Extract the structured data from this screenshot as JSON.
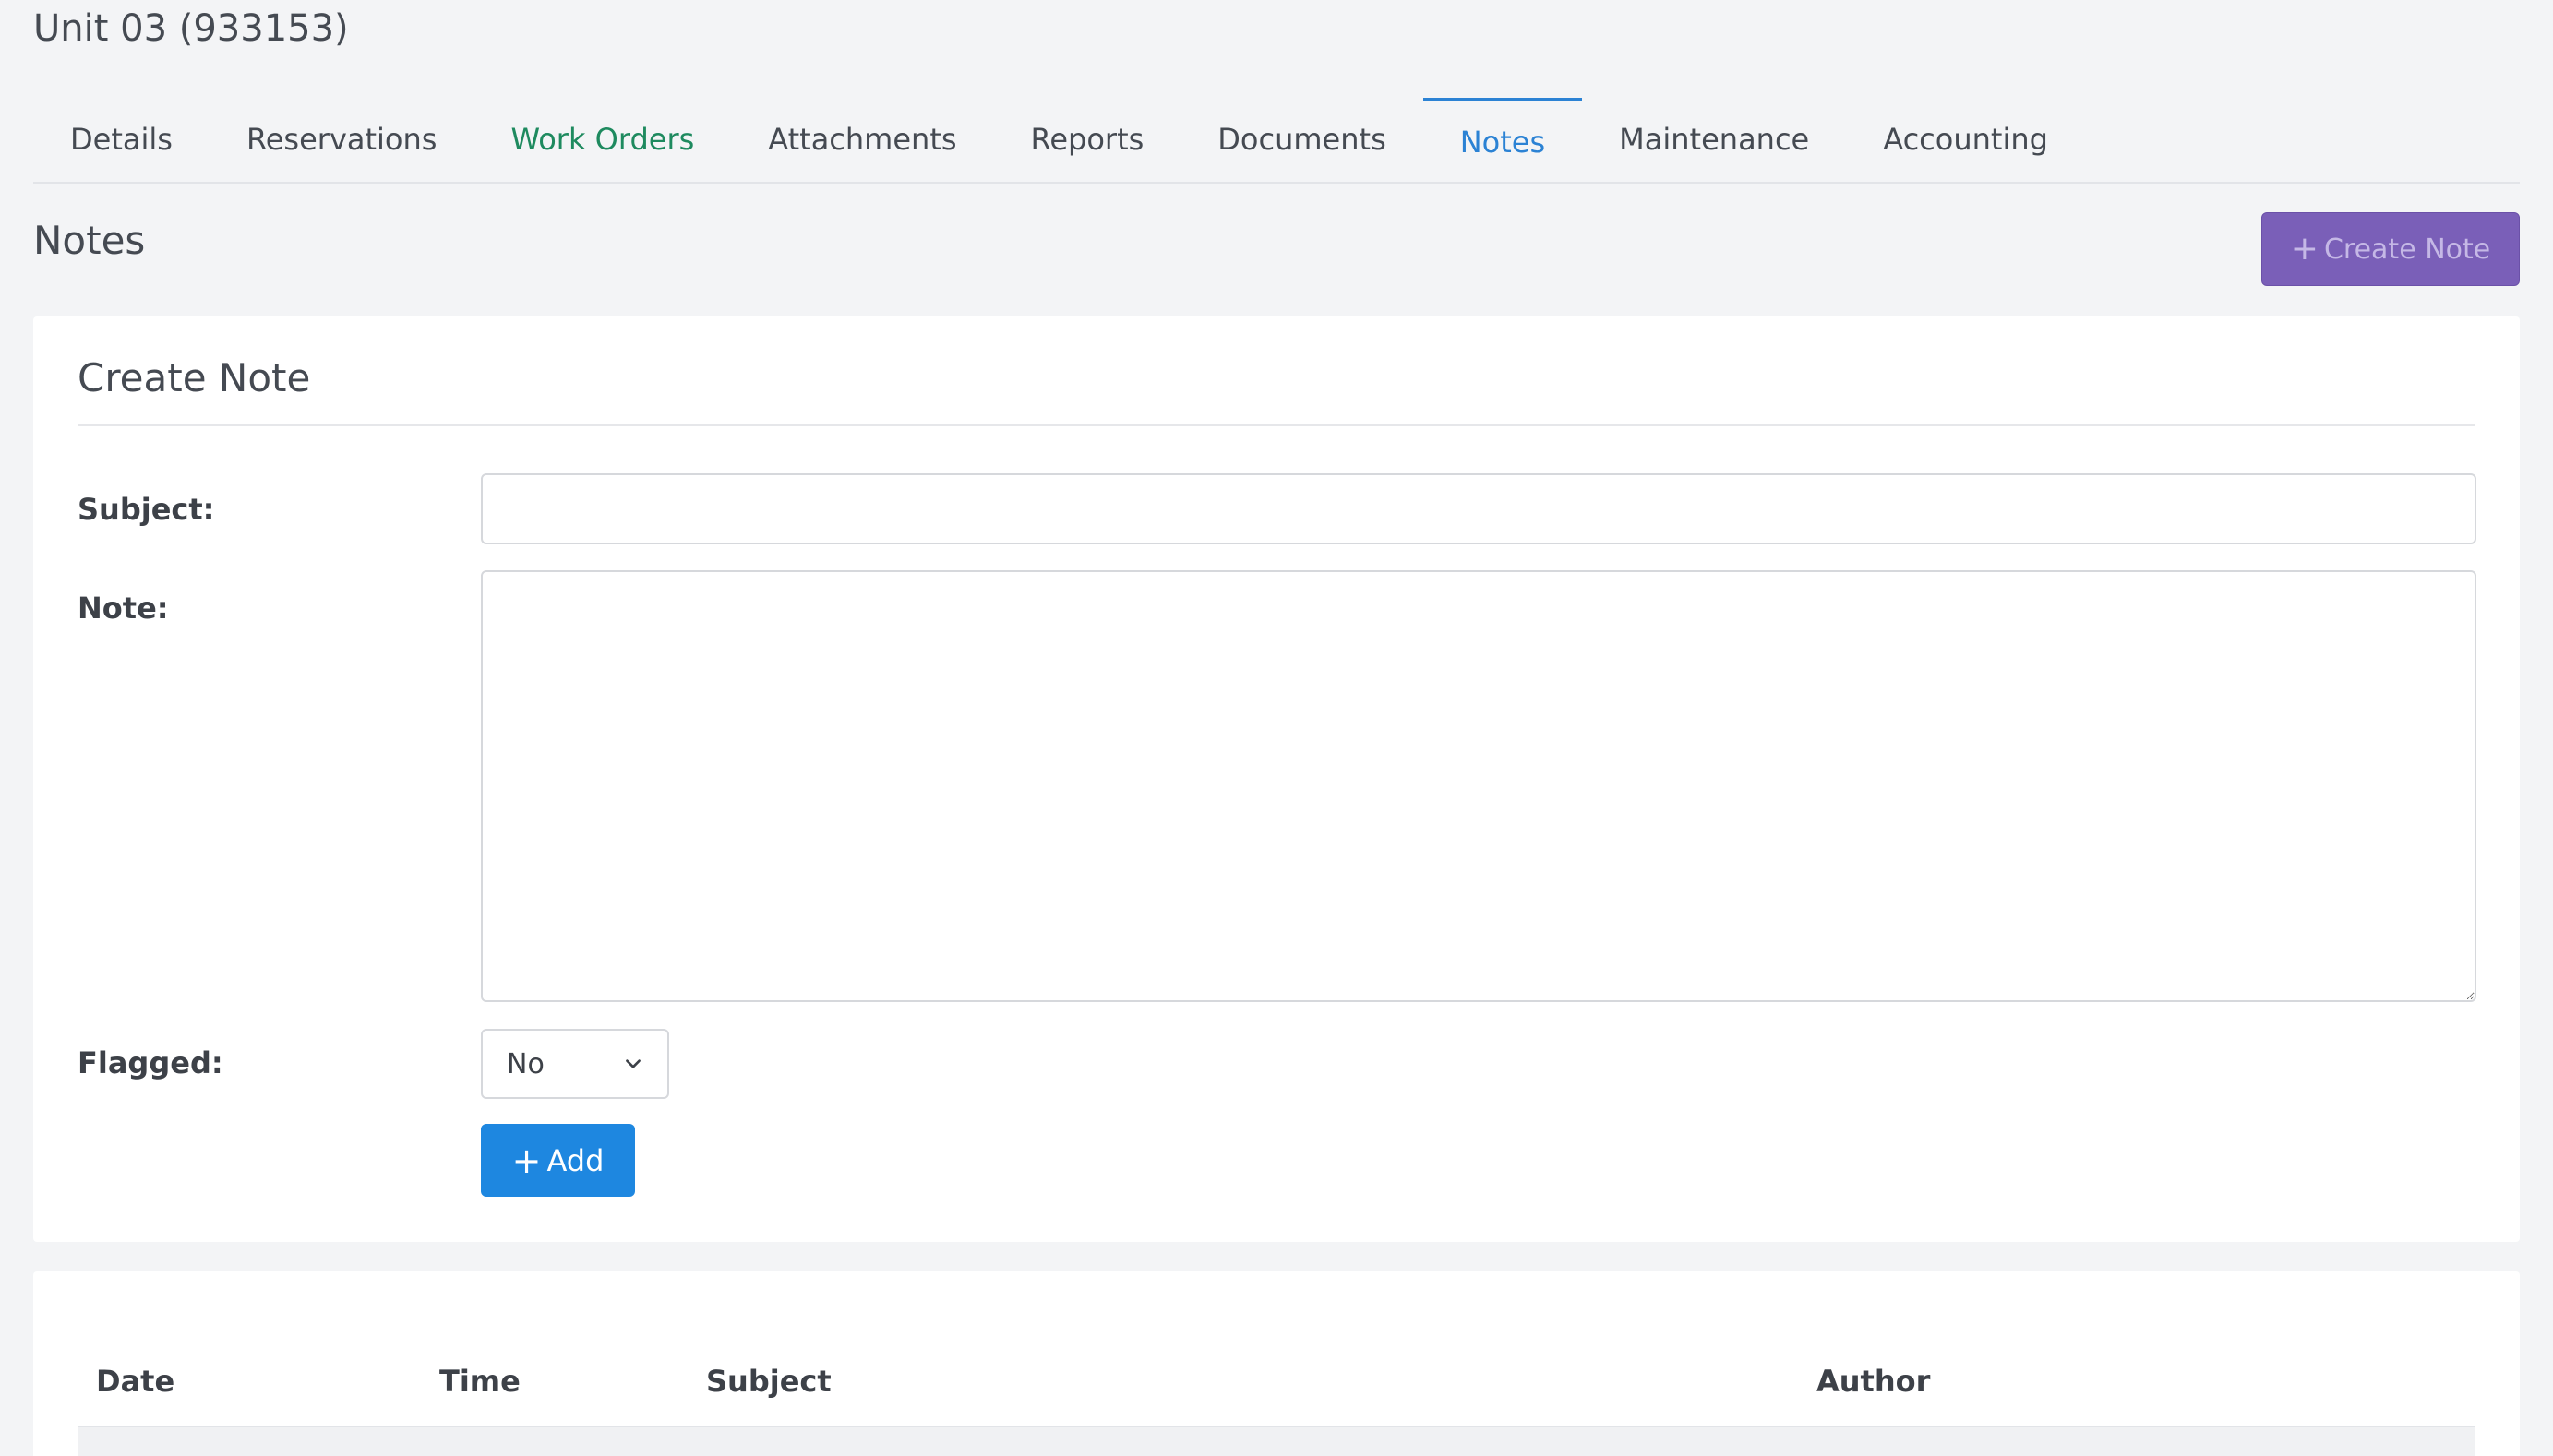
{
  "unit": {
    "title": "Unit 03 (933153)"
  },
  "tabs": [
    {
      "label": "Details"
    },
    {
      "label": "Reservations"
    },
    {
      "label": "Work Orders"
    },
    {
      "label": "Attachments"
    },
    {
      "label": "Reports"
    },
    {
      "label": "Documents"
    },
    {
      "label": "Notes"
    },
    {
      "label": "Maintenance"
    },
    {
      "label": "Accounting"
    }
  ],
  "section": {
    "title": "Notes",
    "create_button_label": "Create Note"
  },
  "form": {
    "heading": "Create Note",
    "subject_label": "Subject:",
    "subject_value": "",
    "note_label": "Note:",
    "note_value": "",
    "flagged_label": "Flagged:",
    "flagged_value": "No",
    "add_button_label": "Add"
  },
  "table": {
    "columns": [
      "Date",
      "Time",
      "Subject",
      "Author"
    ]
  },
  "colors": {
    "accent_blue": "#2b82d4",
    "tab_green": "#1e8a5f",
    "create_button_purple": "#7a5fb8",
    "add_button_blue": "#1e87e0"
  }
}
